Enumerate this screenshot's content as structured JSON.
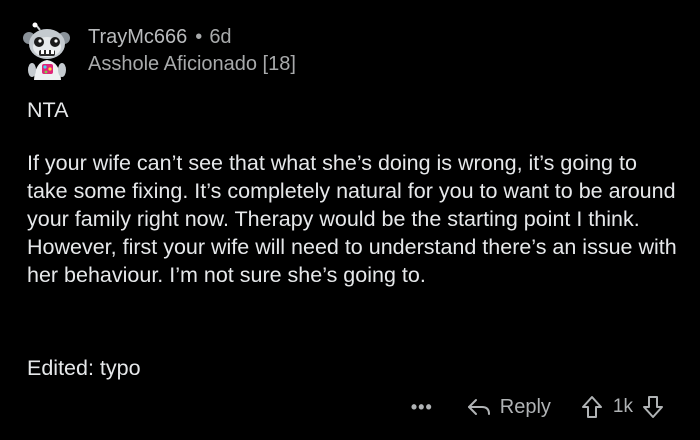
{
  "comment": {
    "username": "TrayMc666",
    "separator": "•",
    "age": "6d",
    "flair": "Asshole Aficionado [18]",
    "verdict": "NTA",
    "paragraph": "If your wife can’t see that what she’s doing is wrong, it’s going to take some fixing. It’s completely natural for you to want to be around your family right now. Therapy would be the starting point I think. However, first your wife will need to understand there’s an issue with her behaviour. I’m not sure she’s going to.",
    "edit_note": "Edited: typo"
  },
  "actions": {
    "more_label": "•••",
    "reply_label": "Reply",
    "vote_count": "1k"
  },
  "icons": {
    "avatar": "snoo-avatar-icon",
    "reply": "reply-arrow-icon",
    "upvote": "upvote-arrow-icon",
    "downvote": "downvote-arrow-icon"
  },
  "colors": {
    "background": "#000000",
    "text": "#e6e8ea",
    "muted": "#a8aaab"
  }
}
